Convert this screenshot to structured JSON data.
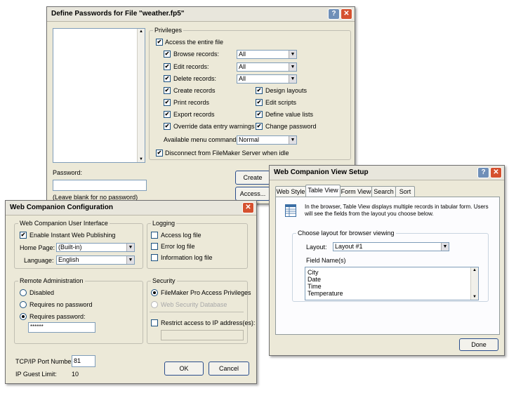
{
  "passwords": {
    "title": "Define Passwords for File \"weather.fp5\"",
    "help_label": "?",
    "close_label": "✕",
    "privileges_label": "Privileges",
    "access_entire_file": "Access the entire file",
    "browse_records": "Browse records:",
    "browse_value": "All",
    "edit_records": "Edit records:",
    "edit_value": "All",
    "delete_records": "Delete records:",
    "delete_value": "All",
    "create_records": "Create records",
    "design_layouts": "Design layouts",
    "print_records": "Print records",
    "edit_scripts": "Edit scripts",
    "export_records": "Export records",
    "define_value_lists": "Define value lists",
    "override_warnings": "Override data entry warnings",
    "change_password": "Change password",
    "menu_commands_label": "Available menu commands:",
    "menu_commands_value": "Normal",
    "disconnect_label": "Disconnect from FileMaker Server when idle",
    "password_label": "Password:",
    "password_hint": "(Leave blank for no password)",
    "create_button": "Create",
    "access_button": "Access..."
  },
  "webconfig": {
    "title": "Web Companion Configuration",
    "close_label": "✕",
    "ui_group": "Web Companion User Interface",
    "enable_iwp": "Enable Instant Web Publishing",
    "home_page_label": "Home Page:",
    "home_page_value": "(Built-in)",
    "language_label": "Language:",
    "language_value": "English",
    "logging_group": "Logging",
    "access_log": "Access log file",
    "error_log": "Error log file",
    "info_log": "Information log file",
    "remote_group": "Remote Administration",
    "disabled": "Disabled",
    "requires_no_password": "Requires no password",
    "requires_password": "Requires password:",
    "password_value": "******",
    "security_group": "Security",
    "fm_access": "FileMaker Pro Access Privileges",
    "web_security_db": "Web Security Database",
    "restrict_ip": "Restrict access to IP address(es):",
    "port_label": "TCP/IP Port Number:",
    "port_value": "81",
    "guest_limit_label": "IP Guest Limit:",
    "guest_limit_value": "10",
    "ok_button": "OK",
    "cancel_button": "Cancel"
  },
  "viewsetup": {
    "title": "Web Companion View Setup",
    "help_label": "?",
    "close_label": "✕",
    "tabs": [
      "Web Style",
      "Table View",
      "Form View",
      "Search",
      "Sort"
    ],
    "description_line1": "In the browser, Table View displays multiple records in tabular form.  Users",
    "description_line2": "will see the fields from the layout you choose below.",
    "layout_group": "Choose layout for browser viewing",
    "layout_label": "Layout:",
    "layout_value": "Layout #1",
    "field_names_label": "Field Name(s)",
    "fields": [
      "City",
      "Date",
      "Time",
      "Temperature"
    ],
    "done_button": "Done"
  }
}
